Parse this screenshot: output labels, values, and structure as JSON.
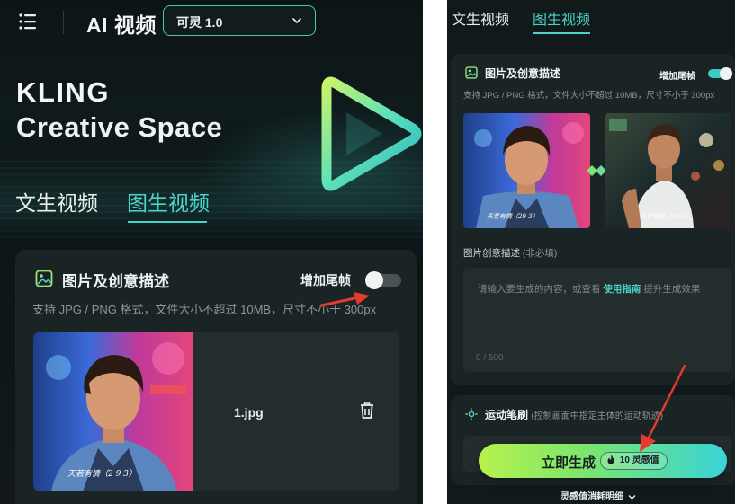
{
  "left_panel": {
    "app_title": "AI 视频",
    "model_select": {
      "value": "可灵 1.0"
    },
    "brand": {
      "line1": "KLING",
      "line2": "Creative Space"
    },
    "tabs": [
      {
        "label": "文生视频",
        "active": false
      },
      {
        "label": "图生视频",
        "active": true
      }
    ],
    "card": {
      "title": "图片及创意描述",
      "tail_frame_label": "增加尾帧",
      "tail_frame_enabled": false,
      "hint": "支持 JPG / PNG 格式，文件大小不超过 10MB，尺寸不小于 300px",
      "uploaded_file": "1.jpg",
      "photo_caption": "天若有情（2 9 3）"
    }
  },
  "right_panel": {
    "tabs": [
      {
        "label": "文生视频",
        "active": false
      },
      {
        "label": "图生视频",
        "active": true
      }
    ],
    "card": {
      "title": "图片及创意描述",
      "tail_frame_label": "增加尾帧",
      "tail_frame_enabled": true,
      "hint": "支持 JPG / PNG 格式，文件大小不超过 10MB，尺寸不小于 300px",
      "photo1_caption": "天若有情（29 3）",
      "photo2_caption": "天若有情（29 3）",
      "desc_label": "图片创意描述",
      "desc_optional": "(非必填)",
      "placeholder_prefix": "请输入要生成的内容，或查看",
      "placeholder_link": "使用指南",
      "placeholder_suffix": "提升生成效果",
      "char_count": "0 / 500"
    },
    "motion_card": {
      "title": "运动笔刷",
      "subtitle": "(控制画面中指定主体的运动轨迹)"
    },
    "generate_button": {
      "label": "立即生成",
      "cost": "10 灵感值"
    },
    "footer": {
      "label": "灵感值消耗明细"
    }
  },
  "colors": {
    "accent": "#48d3c8",
    "background_dark": "#11191a",
    "card": "#1b2425",
    "annotation_arrow": "#e53a2f"
  }
}
